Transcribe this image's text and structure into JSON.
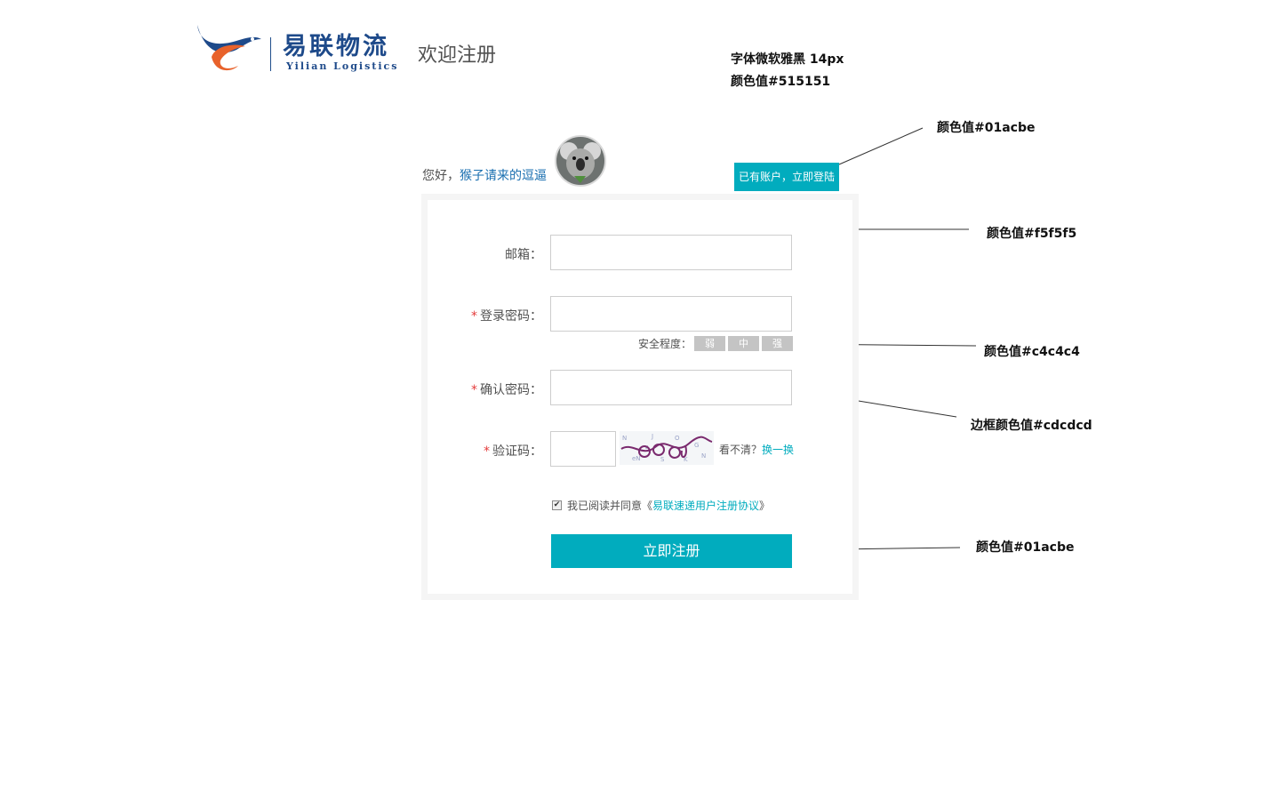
{
  "header": {
    "brand_cn": "易联物流",
    "brand_en": "Yilian Logistics",
    "page_title": "欢迎注册"
  },
  "annotations": {
    "font_note": "字体微软雅黑 14px",
    "text_color_note": "颜色值#515151",
    "login_btn_color_note": "颜色值#01acbe",
    "panel_bg_note": "颜色值#f5f5f5",
    "strength_color_note": "颜色值#c4c4c4",
    "border_color_note": "边框颜色值#cdcdcd",
    "submit_color_note": "颜色值#01acbe"
  },
  "user_bar": {
    "greeting": "您好，",
    "username": "猴子请来的逗逼",
    "login_link": "已有账户，立即登陆"
  },
  "form": {
    "email_label": "邮箱：",
    "password_label": "登录密码：",
    "confirm_label": "确认密码：",
    "captcha_label": "验证码：",
    "required_mark": "*",
    "strength_label": "安全程度：",
    "strength_levels": [
      "弱",
      "中",
      "强"
    ],
    "captcha_hint": "看不清？",
    "captcha_refresh": "换一换",
    "agree_prefix": "我已阅读并同意《",
    "agree_link": "易联速递用户注册协议",
    "agree_suffix": "》",
    "agree_checked": true,
    "submit_label": "立即注册"
  },
  "colors": {
    "text": "#515151",
    "accent": "#01acbe",
    "panel_bg": "#f5f5f5",
    "strength": "#c4c4c4",
    "border": "#cdcdcd",
    "required": "#e43b3b"
  }
}
